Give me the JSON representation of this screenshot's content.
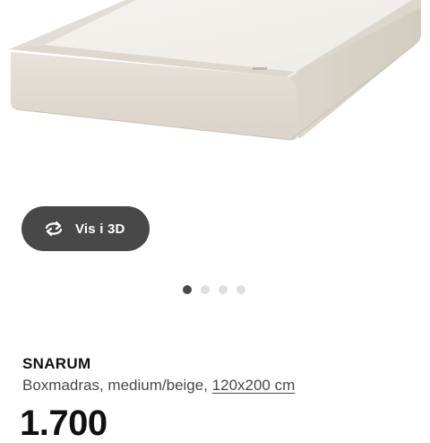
{
  "product": {
    "name": "SNARUM",
    "description": "Boxmadras, medium/beige, ",
    "size_link": "120x200 cm",
    "price": "1.700"
  },
  "gallery": {
    "view3d_label": "Vis i 3D",
    "view3d_icon": "rotate-360-icon",
    "dots_total": 4,
    "dots_active_index": 0
  },
  "colors": {
    "button_bg": "#484848",
    "dot_active": "#484848",
    "dot_inactive": "#dfdfdf",
    "product_fabric": "#e6e1d9"
  }
}
